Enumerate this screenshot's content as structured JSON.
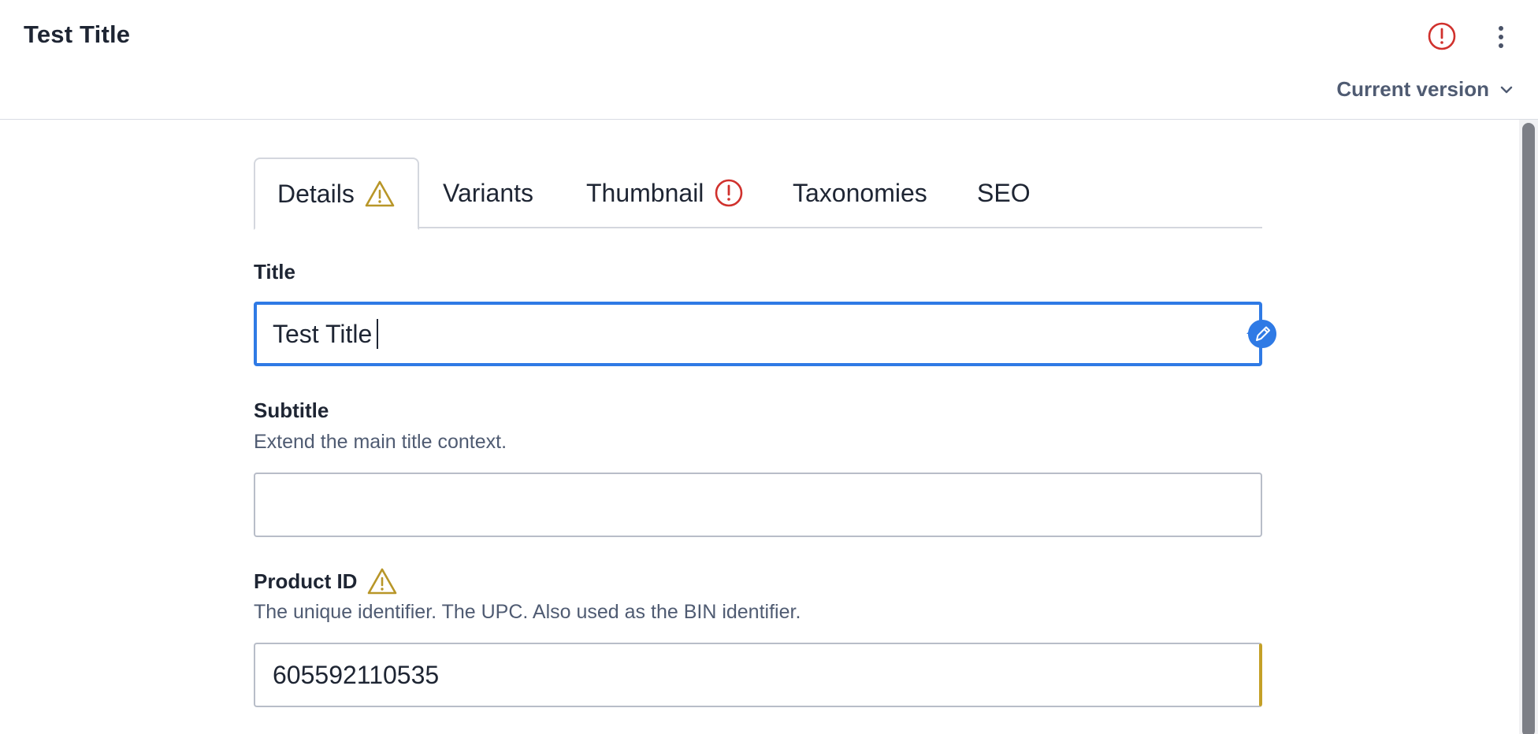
{
  "header": {
    "title": "Test Title",
    "alert_icon": "alert-circle-icon",
    "menu_icon": "kebab-menu-icon",
    "version_label": "Current version",
    "version_icon": "chevron-down-icon"
  },
  "tabs": [
    {
      "label": "Details",
      "active": true,
      "icon": "warning-triangle-icon"
    },
    {
      "label": "Variants",
      "active": false
    },
    {
      "label": "Thumbnail",
      "active": false,
      "icon": "alert-circle-icon"
    },
    {
      "label": "Taxonomies",
      "active": false
    },
    {
      "label": "SEO",
      "active": false
    }
  ],
  "fields": {
    "title": {
      "label": "Title",
      "value": "Test Title",
      "action_icon": "pencil-icon"
    },
    "subtitle": {
      "label": "Subtitle",
      "description": "Extend the main title context.",
      "value": ""
    },
    "product_id": {
      "label": "Product ID",
      "description": "The unique identifier. The UPC. Also used as the BIN identifier.",
      "value": "605592110535",
      "icon": "warning-triangle-icon"
    }
  },
  "colors": {
    "error": "#d0312d",
    "warning": "#b89628",
    "focus": "#2f7ae5",
    "text": "#1e2533",
    "muted": "#4f5b72"
  }
}
